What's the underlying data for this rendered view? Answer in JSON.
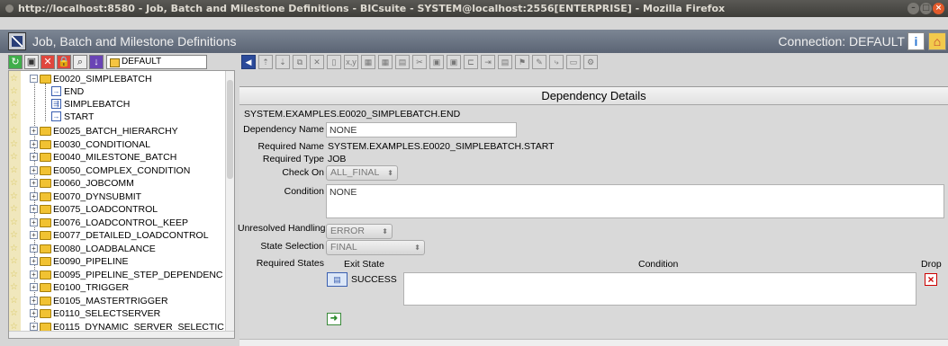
{
  "browser": {
    "window_title": "http://localhost:8580 - Job, Batch and Milestone Definitions - BICsuite - SYSTEM@localhost:2556[ENTERPRISE] - Mozilla Firefox"
  },
  "app": {
    "title": "Job, Batch and Milestone Definitions",
    "connection": "Connection: DEFAULT",
    "info_icon": "info-icon",
    "home_icon": "home-icon"
  },
  "left_toolbar": {
    "scope_value": "DEFAULT"
  },
  "tree": {
    "open_folder": "E0020_SIMPLEBATCH",
    "children": [
      "END",
      "SIMPLEBATCH",
      "START"
    ],
    "folders": [
      "E0025_BATCH_HIERARCHY",
      "E0030_CONDITIONAL",
      "E0040_MILESTONE_BATCH",
      "E0050_COMPLEX_CONDITION",
      "E0060_JOBCOMM",
      "E0070_DYNSUBMIT",
      "E0075_LOADCONTROL",
      "E0076_LOADCONTROL_KEEP",
      "E0077_DETAILED_LOADCONTROL",
      "E0080_LOADBALANCE",
      "E0090_PIPELINE",
      "E0095_PIPELINE_STEP_DEPENDENC",
      "E0100_TRIGGER",
      "E0105_MASTERTRIGGER",
      "E0110_SELECTSERVER",
      "E0115_DYNAMIC_SERVER_SELECTIC"
    ]
  },
  "details": {
    "header": "Dependency Details",
    "path": "SYSTEM.EXAMPLES.E0020_SIMPLEBATCH.END",
    "dependency_name_label": "Dependency Name",
    "dependency_name_value": "NONE",
    "required_name_label": "Required Name",
    "required_name_value": "SYSTEM.EXAMPLES.E0020_SIMPLEBATCH.START",
    "required_type_label": "Required Type",
    "required_type_value": "JOB",
    "check_on_label": "Check On",
    "check_on_value": "ALL_FINAL",
    "condition_label": "Condition",
    "condition_value": "NONE",
    "unresolved_label": "Unresolved Handling",
    "unresolved_value": "ERROR",
    "state_selection_label": "State Selection",
    "state_selection_value": "FINAL",
    "required_states_label": "Required States",
    "col_exit_state": "Exit State",
    "col_condition": "Condition",
    "col_drop": "Drop",
    "states": [
      {
        "exit_state": "SUCCESS",
        "condition": ""
      }
    ]
  }
}
